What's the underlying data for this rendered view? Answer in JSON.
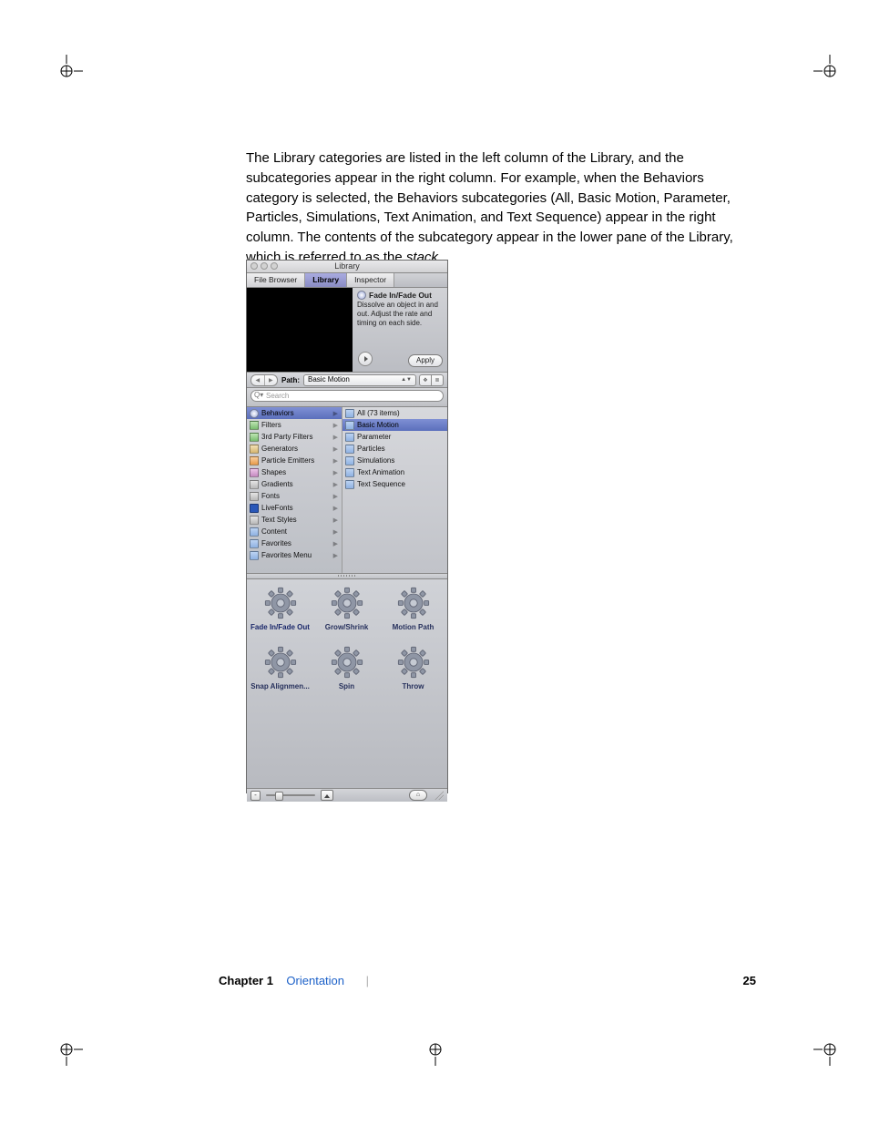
{
  "paragraph": "The Library categories are listed in the left column of the Library, and the subcategories appear in the right column. For example, when the Behaviors category is selected, the Behaviors subcategories (All, Basic Motion, Parameter, Particles, Simulations, Text Animation, and Text Sequence) appear in the right column. The contents of the subcategory appear in the lower pane of the Library, which is referred to as the ",
  "paragraph_italic": "stack",
  "paragraph_end": ".",
  "panel": {
    "window_title": "Library",
    "tabs": {
      "file_browser": "File Browser",
      "library": "Library",
      "inspector": "Inspector"
    },
    "preview": {
      "title": "Fade In/Fade Out",
      "description": "Dissolve an object in and out. Adjust the rate and timing on each side.",
      "apply": "Apply"
    },
    "path_label": "Path:",
    "path_value": "Basic Motion",
    "search_placeholder": "Search",
    "categories": [
      "Behaviors",
      "Filters",
      "3rd Party Filters",
      "Generators",
      "Particle Emitters",
      "Shapes",
      "Gradients",
      "Fonts",
      "LiveFonts",
      "Text Styles",
      "Content",
      "Favorites",
      "Favorites Menu"
    ],
    "subcategories": [
      "All (73 items)",
      "Basic Motion",
      "Parameter",
      "Particles",
      "Simulations",
      "Text Animation",
      "Text Sequence"
    ],
    "subcat_selected_index": 1,
    "stack_items": [
      "Fade In/Fade Out",
      "Grow/Shrink",
      "Motion Path",
      "Snap Alignmen...",
      "Spin",
      "Throw"
    ],
    "stack_selected_index": 0
  },
  "footer": {
    "chapter_label": "Chapter 1",
    "chapter_link": "Orientation",
    "page_no": "25"
  }
}
